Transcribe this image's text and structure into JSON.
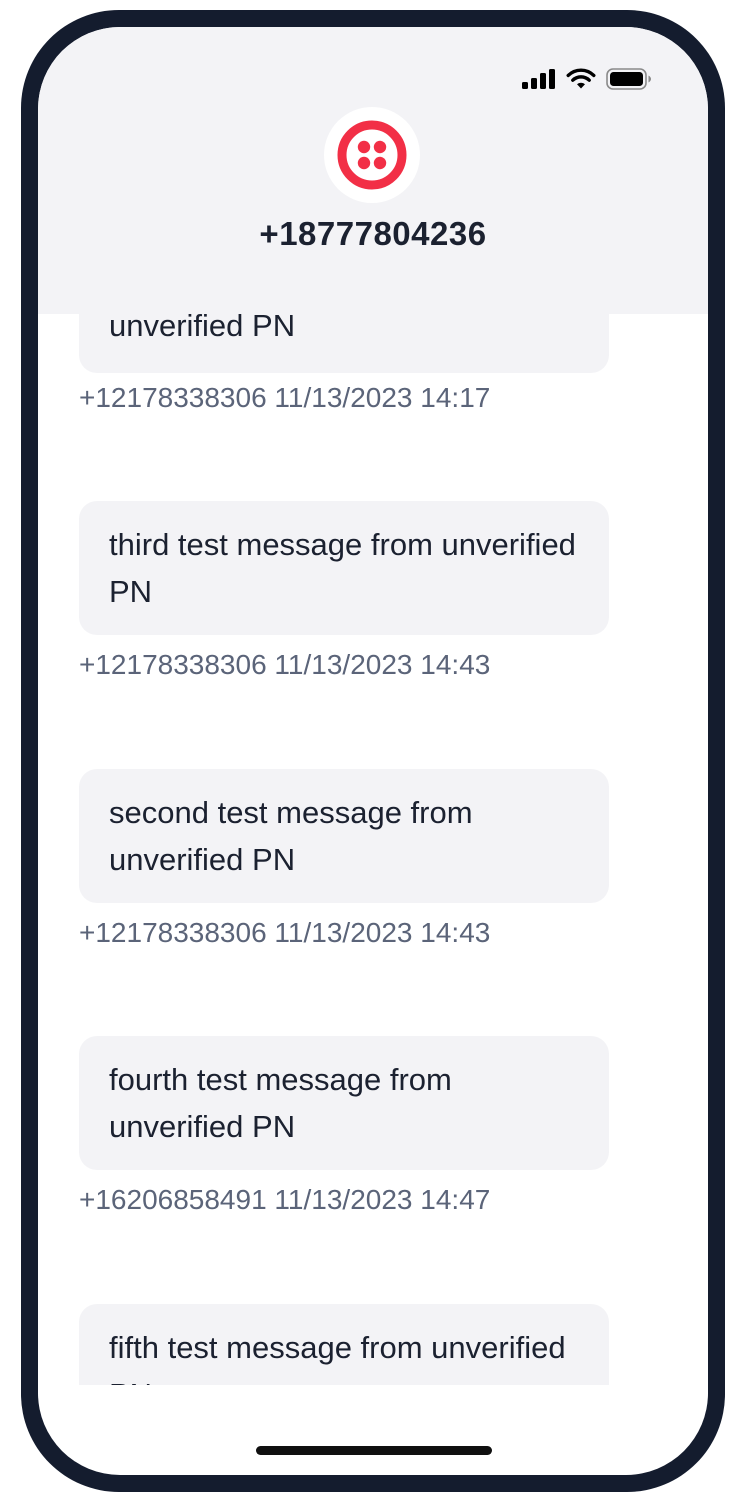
{
  "status_bar": {
    "icons": [
      "cellular-signal-icon",
      "wifi-icon",
      "battery-icon"
    ]
  },
  "header": {
    "logo": "twilio-logo",
    "logo_color": "#f22f46",
    "title": "+18777804236"
  },
  "messages": [
    {
      "body": "unverified PN",
      "meta": "+12178338306 11/13/2023 14:17"
    },
    {
      "body": "third test message from unverified PN",
      "meta": "+12178338306 11/13/2023 14:43"
    },
    {
      "body": "second test message from unverified PN",
      "meta": "+12178338306 11/13/2023 14:43"
    },
    {
      "body": "fourth test message from unverified PN",
      "meta": "+16206858491 11/13/2023 14:47"
    },
    {
      "body": "fifth test message from unverified PN",
      "meta": ""
    }
  ],
  "colors": {
    "frame": "#141c2e",
    "header_bg": "#f3f3f6",
    "bubble_bg": "#f3f3f6",
    "text": "#1b2130",
    "meta_text": "#5b6479"
  }
}
